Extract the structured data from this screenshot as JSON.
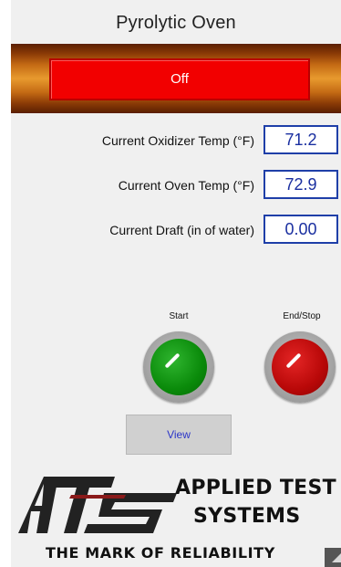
{
  "window": {
    "title": "Pyrolytic Oven"
  },
  "status": {
    "label": "Off",
    "color": "#f20000"
  },
  "readings": [
    {
      "label": "Current Oxidizer Temp (°F)",
      "value": "71.2"
    },
    {
      "label": "Current Oven Temp (°F)",
      "value": "72.9"
    },
    {
      "label": "Current Draft (in of water)",
      "value": "0.00"
    }
  ],
  "controls": {
    "start_label": "Start",
    "stop_label": "End/Stop",
    "start_color": "#0a8a0a",
    "stop_color": "#b80808",
    "view_label": "View"
  },
  "logo": {
    "mark": "ATS",
    "line1": "APPLIED TEST",
    "line2": "SYSTEMS",
    "tagline": "THE MARK OF RELIABILITY"
  },
  "icons": {
    "corner": "resize-grip-icon"
  }
}
